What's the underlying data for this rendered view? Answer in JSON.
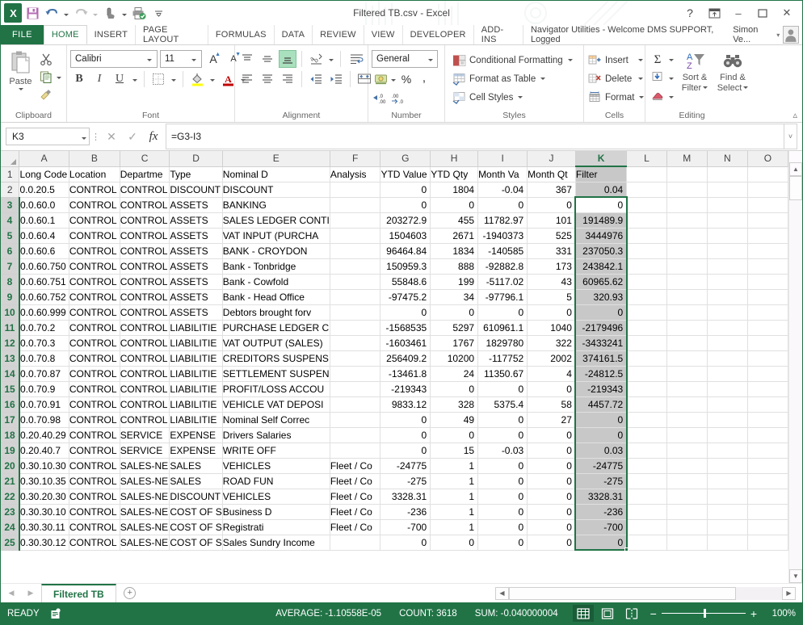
{
  "window": {
    "title": "Filtered TB.csv - Excel",
    "help_icon": "?",
    "ribbon_display_icon": "ribbon-options",
    "minimize_icon": "–",
    "maximize_icon": "❑",
    "close_icon": "✕"
  },
  "qat": {
    "app_logo": "X",
    "save_icon": "save-icon",
    "undo_icon": "undo-icon",
    "redo_icon": "redo-icon",
    "touch_icon": "touch-mode-icon",
    "print_preview_icon": "print-preview-icon",
    "customize_icon": "customize-qat-icon"
  },
  "ribbon_tabs": {
    "file": "FILE",
    "items": [
      {
        "label": "HOME",
        "active": true
      },
      {
        "label": "INSERT",
        "active": false
      },
      {
        "label": "PAGE LAYOUT",
        "active": false
      },
      {
        "label": "FORMULAS",
        "active": false
      },
      {
        "label": "DATA",
        "active": false
      },
      {
        "label": "REVIEW",
        "active": false
      },
      {
        "label": "VIEW",
        "active": false
      },
      {
        "label": "DEVELOPER",
        "active": false
      },
      {
        "label": "ADD-INS",
        "active": false
      }
    ],
    "addin_banner": "Navigator Utilities - Welcome DMS SUPPORT, Logged",
    "user_name": "Simon Ve...",
    "user_caret": "▾"
  },
  "ribbon": {
    "clipboard": {
      "label": "Clipboard",
      "paste_label": "Paste",
      "cut_icon": "scissors-icon",
      "copy_icon": "copy-icon",
      "format_painter_icon": "format-painter-icon",
      "paste_icon": "paste-icon"
    },
    "font": {
      "label": "Font",
      "family": "Calibri",
      "size": "11",
      "grow_font": "A",
      "shrink_font": "A",
      "bold": "B",
      "italic": "I",
      "underline": "U",
      "borders_icon": "borders-icon",
      "fill_color_icon": "fill-color-icon",
      "font_color_icon": "font-color-icon"
    },
    "alignment": {
      "label": "Alignment",
      "top_align_icon": "align-top-icon",
      "middle_align_icon": "align-middle-icon",
      "bottom_align_icon": "align-bottom-icon",
      "orientation_icon": "orientation-icon",
      "wrap_text_icon": "wrap-text-icon",
      "align_left_icon": "align-left-icon",
      "align_center_icon": "align-center-icon",
      "align_right_icon": "align-right-icon",
      "decrease_indent_icon": "decrease-indent-icon",
      "increase_indent_icon": "increase-indent-icon",
      "merge_center_icon": "merge-and-center-icon"
    },
    "number": {
      "label": "Number",
      "format": "General",
      "accounting_icon": "accounting-format-icon",
      "percent": "%",
      "comma": ",",
      "decrease_decimal": ".00",
      "increase_decimal": ".0"
    },
    "styles": {
      "label": "Styles",
      "conditional_formatting": "Conditional Formatting",
      "format_as_table": "Format as Table",
      "cell_styles": "Cell Styles"
    },
    "cells": {
      "label": "Cells",
      "insert": "Insert",
      "delete": "Delete",
      "format": "Format"
    },
    "editing": {
      "label": "Editing",
      "autosum_icon": "autosum-sigma-icon",
      "fill_icon": "fill-down-icon",
      "clear_icon": "clear-eraser-icon",
      "sort_filter": "Sort &\nFilter",
      "sort_filter_l1": "Sort &",
      "sort_filter_l2": "Filter",
      "find_select_l1": "Find &",
      "find_select_l2": "Select"
    },
    "collapse_icon": "collapse-ribbon-icon"
  },
  "formula_bar": {
    "name_box": "K3",
    "cancel_icon": "✕",
    "enter_icon": "✓",
    "function_icon": "fx",
    "formula": "=G3-I3",
    "expand_icon": "˅"
  },
  "grid": {
    "columns": [
      "A",
      "B",
      "C",
      "D",
      "E",
      "F",
      "G",
      "H",
      "I",
      "J",
      "K",
      "L",
      "M",
      "N",
      "O"
    ],
    "selected_column": "K",
    "active_cell": "K3",
    "row_numbers": [
      1,
      2,
      3,
      4,
      5,
      6,
      7,
      8,
      9,
      10,
      11,
      12,
      13,
      14,
      15,
      16,
      17,
      18,
      19,
      20,
      21,
      22,
      23,
      24,
      25
    ],
    "headers": {
      "A": "Long Code",
      "B": "Location",
      "C": "Departme",
      "D": "Type",
      "E": "Nominal D",
      "F": "Analysis",
      "G": "YTD Value",
      "H": "YTD Qty",
      "I": "Month Va",
      "J": "Month Qt",
      "K": "Filter"
    },
    "rows": [
      {
        "n": 2,
        "A": "0.0.20.5",
        "B": "CONTROL",
        "C": "CONTROL",
        "D": "DISCOUNT",
        "E": "DISCOUNT",
        "F": "",
        "G": "0",
        "H": "1804",
        "I": "-0.04",
        "J": "367",
        "K": "0.04"
      },
      {
        "n": 3,
        "A": "0.0.60.0",
        "B": "CONTROL",
        "C": "CONTROL",
        "D": "ASSETS",
        "E": "BANKING",
        "F": "",
        "G": "0",
        "H": "0",
        "I": "0",
        "J": "0",
        "K": "0"
      },
      {
        "n": 4,
        "A": "0.0.60.1",
        "B": "CONTROL",
        "C": "CONTROL",
        "D": "ASSETS",
        "E": "SALES LEDGER CONTI",
        "F": "",
        "G": "203272.9",
        "H": "455",
        "I": "11782.97",
        "J": "101",
        "K": "191489.9"
      },
      {
        "n": 5,
        "A": "0.0.60.4",
        "B": "CONTROL",
        "C": "CONTROL",
        "D": "ASSETS",
        "E": "VAT INPUT (PURCHA",
        "F": "",
        "G": "1504603",
        "H": "2671",
        "I": "-1940373",
        "J": "525",
        "K": "3444976"
      },
      {
        "n": 6,
        "A": "0.0.60.6",
        "B": "CONTROL",
        "C": "CONTROL",
        "D": "ASSETS",
        "E": "BANK - CROYDON",
        "F": "",
        "G": "96464.84",
        "H": "1834",
        "I": "-140585",
        "J": "331",
        "K": "237050.3"
      },
      {
        "n": 7,
        "A": "0.0.60.750",
        "B": "CONTROL",
        "C": "CONTROL",
        "D": "ASSETS",
        "E": "Bank - Tonbridge",
        "F": "",
        "G": "150959.3",
        "H": "888",
        "I": "-92882.8",
        "J": "173",
        "K": "243842.1"
      },
      {
        "n": 8,
        "A": "0.0.60.751",
        "B": "CONTROL",
        "C": "CONTROL",
        "D": "ASSETS",
        "E": "Bank - Cowfold",
        "F": "",
        "G": "55848.6",
        "H": "199",
        "I": "-5117.02",
        "J": "43",
        "K": "60965.62"
      },
      {
        "n": 9,
        "A": "0.0.60.752",
        "B": "CONTROL",
        "C": "CONTROL",
        "D": "ASSETS",
        "E": "Bank - Head Office",
        "F": "",
        "G": "-97475.2",
        "H": "34",
        "I": "-97796.1",
        "J": "5",
        "K": "320.93"
      },
      {
        "n": 10,
        "A": "0.0.60.999",
        "B": "CONTROL",
        "C": "CONTROL",
        "D": "ASSETS",
        "E": "Debtors brought forv",
        "F": "",
        "G": "0",
        "H": "0",
        "I": "0",
        "J": "0",
        "K": "0"
      },
      {
        "n": 11,
        "A": "0.0.70.2",
        "B": "CONTROL",
        "C": "CONTROL",
        "D": "LIABILITIE",
        "E": "PURCHASE LEDGER C",
        "F": "",
        "G": "-1568535",
        "H": "5297",
        "I": "610961.1",
        "J": "1040",
        "K": "-2179496"
      },
      {
        "n": 12,
        "A": "0.0.70.3",
        "B": "CONTROL",
        "C": "CONTROL",
        "D": "LIABILITIE",
        "E": "VAT OUTPUT (SALES)",
        "F": "",
        "G": "-1603461",
        "H": "1767",
        "I": "1829780",
        "J": "322",
        "K": "-3433241"
      },
      {
        "n": 13,
        "A": "0.0.70.8",
        "B": "CONTROL",
        "C": "CONTROL",
        "D": "LIABILITIE",
        "E": "CREDITORS SUSPENS",
        "F": "",
        "G": "256409.2",
        "H": "10200",
        "I": "-117752",
        "J": "2002",
        "K": "374161.5"
      },
      {
        "n": 14,
        "A": "0.0.70.87",
        "B": "CONTROL",
        "C": "CONTROL",
        "D": "LIABILITIE",
        "E": "SETTLEMENT SUSPEN",
        "F": "",
        "G": "-13461.8",
        "H": "24",
        "I": "11350.67",
        "J": "4",
        "K": "-24812.5"
      },
      {
        "n": 15,
        "A": "0.0.70.9",
        "B": "CONTROL",
        "C": "CONTROL",
        "D": "LIABILITIE",
        "E": "PROFIT/LOSS ACCOU",
        "F": "",
        "G": "-219343",
        "H": "0",
        "I": "0",
        "J": "0",
        "K": "-219343"
      },
      {
        "n": 16,
        "A": "0.0.70.91",
        "B": "CONTROL",
        "C": "CONTROL",
        "D": "LIABILITIE",
        "E": "VEHICLE VAT DEPOSI",
        "F": "",
        "G": "9833.12",
        "H": "328",
        "I": "5375.4",
        "J": "58",
        "K": "4457.72"
      },
      {
        "n": 17,
        "A": "0.0.70.98",
        "B": "CONTROL",
        "C": "CONTROL",
        "D": "LIABILITIE",
        "E": "Nominal Self Correc",
        "F": "",
        "G": "0",
        "H": "49",
        "I": "0",
        "J": "27",
        "K": "0"
      },
      {
        "n": 18,
        "A": "0.20.40.29",
        "B": "CONTROL",
        "C": "SERVICE",
        "D": "EXPENSE",
        "E": "Drivers Salaries",
        "F": "",
        "G": "0",
        "H": "0",
        "I": "0",
        "J": "0",
        "K": "0"
      },
      {
        "n": 19,
        "A": "0.20.40.7",
        "B": "CONTROL",
        "C": "SERVICE",
        "D": "EXPENSE",
        "E": "WRITE OFF",
        "F": "",
        "G": "0",
        "H": "15",
        "I": "-0.03",
        "J": "0",
        "K": "0.03"
      },
      {
        "n": 20,
        "A": "0.30.10.30",
        "B": "CONTROL",
        "C": "SALES-NE",
        "D": "SALES",
        "E": "VEHICLES",
        "F": "Fleet / Co",
        "G": "-24775",
        "H": "1",
        "I": "0",
        "J": "0",
        "K": "-24775"
      },
      {
        "n": 21,
        "A": "0.30.10.35",
        "B": "CONTROL",
        "C": "SALES-NE",
        "D": "SALES",
        "E": "ROAD FUN",
        "F": "Fleet / Co",
        "G": "-275",
        "H": "1",
        "I": "0",
        "J": "0",
        "K": "-275"
      },
      {
        "n": 22,
        "A": "0.30.20.30",
        "B": "CONTROL",
        "C": "SALES-NE",
        "D": "DISCOUNT",
        "E": "VEHICLES",
        "F": "Fleet / Co",
        "G": "3328.31",
        "H": "1",
        "I": "0",
        "J": "0",
        "K": "3328.31"
      },
      {
        "n": 23,
        "A": "0.30.30.10",
        "B": "CONTROL",
        "C": "SALES-NE",
        "D": "COST OF S",
        "E": "Business D",
        "F": "Fleet / Co",
        "G": "-236",
        "H": "1",
        "I": "0",
        "J": "0",
        "K": "-236"
      },
      {
        "n": 24,
        "A": "0.30.30.11",
        "B": "CONTROL",
        "C": "SALES-NE",
        "D": "COST OF S",
        "E": "Registrati",
        "F": "Fleet / Co",
        "G": "-700",
        "H": "1",
        "I": "0",
        "J": "0",
        "K": "-700"
      },
      {
        "n": 25,
        "A": "0.30.30.12",
        "B": "CONTROL",
        "C": "SALES-NE",
        "D": "COST OF S",
        "E": "Sales Sundry Income",
        "F": "",
        "G": "0",
        "H": "0",
        "I": "0",
        "J": "0",
        "K": "0"
      }
    ]
  },
  "sheet_tabs": {
    "first_arrow": "◀",
    "last_arrow": "▶",
    "tabs": [
      {
        "label": "Filtered TB",
        "active": true
      }
    ],
    "new_sheet_icon": "+"
  },
  "status_bar": {
    "mode": "READY",
    "macro_icon": "macro-record-icon",
    "average": "AVERAGE: -1.10558E-05",
    "count": "COUNT: 3618",
    "sum": "SUM: -0.040000004",
    "normal_view_icon": "normal-view-icon",
    "page_layout_icon": "page-layout-view-icon",
    "page_break_icon": "page-break-preview-icon",
    "zoom_out": "−",
    "zoom_in": "+",
    "zoom_level": "100%"
  },
  "colors": {
    "excel_green": "#217346",
    "selection_gray": "#c8c8c8",
    "header_gray": "#f0f0f0"
  }
}
